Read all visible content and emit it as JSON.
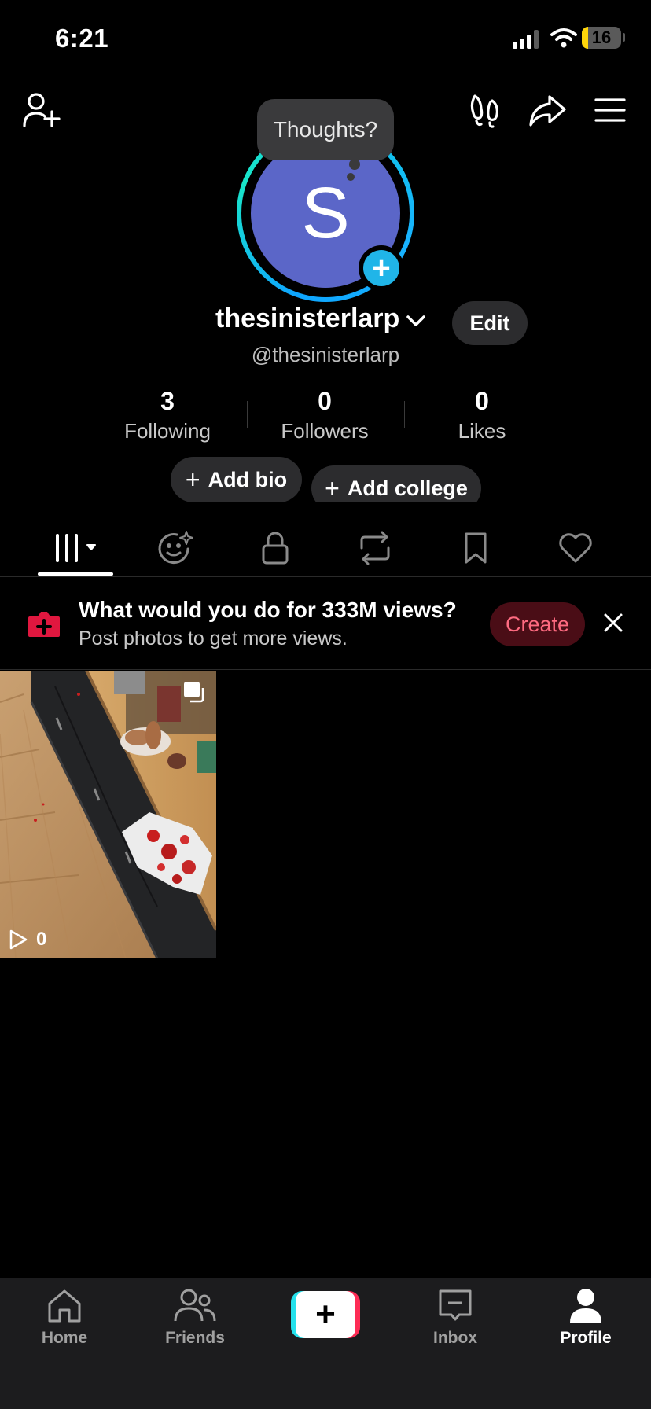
{
  "status_bar": {
    "time": "6:21",
    "battery_level": "16",
    "battery_fraction": 0.16,
    "battery_color": "#ffd60a"
  },
  "top_nav": {
    "add_friend_icon": "person-plus-icon",
    "footprints_icon": "footprints-icon",
    "share_icon": "share-icon",
    "menu_icon": "hamburger-menu-icon"
  },
  "profile": {
    "tooltip": "Thoughts?",
    "avatar_letter": "S",
    "avatar_color": "#5b66c8",
    "username": "thesinisterlarp",
    "handle": "@thesinisterlarp",
    "edit_label": "Edit"
  },
  "stats": [
    {
      "value": "3",
      "label": "Following"
    },
    {
      "value": "0",
      "label": "Followers"
    },
    {
      "value": "0",
      "label": "Likes"
    }
  ],
  "pills": {
    "add_bio": "Add bio",
    "add_college": "Add college"
  },
  "tabs": [
    {
      "icon": "videos-grid-icon",
      "active": true
    },
    {
      "icon": "sparkle-face-icon",
      "active": false
    },
    {
      "icon": "lock-icon",
      "active": false
    },
    {
      "icon": "repost-icon",
      "active": false
    },
    {
      "icon": "bookmark-icon",
      "active": false
    },
    {
      "icon": "heart-icon",
      "active": false
    }
  ],
  "banner": {
    "title": "What would you do for 333M views?",
    "subtitle": "Post photos to get more views.",
    "create_label": "Create",
    "accent": "#fe2c55"
  },
  "videos": [
    {
      "views": "0"
    }
  ],
  "bottom_nav": {
    "items": [
      {
        "label": "Home",
        "icon": "home-icon"
      },
      {
        "label": "Friends",
        "icon": "friends-icon"
      },
      {
        "label": "Inbox",
        "icon": "inbox-icon"
      },
      {
        "label": "Profile",
        "icon": "profile-icon"
      }
    ]
  }
}
